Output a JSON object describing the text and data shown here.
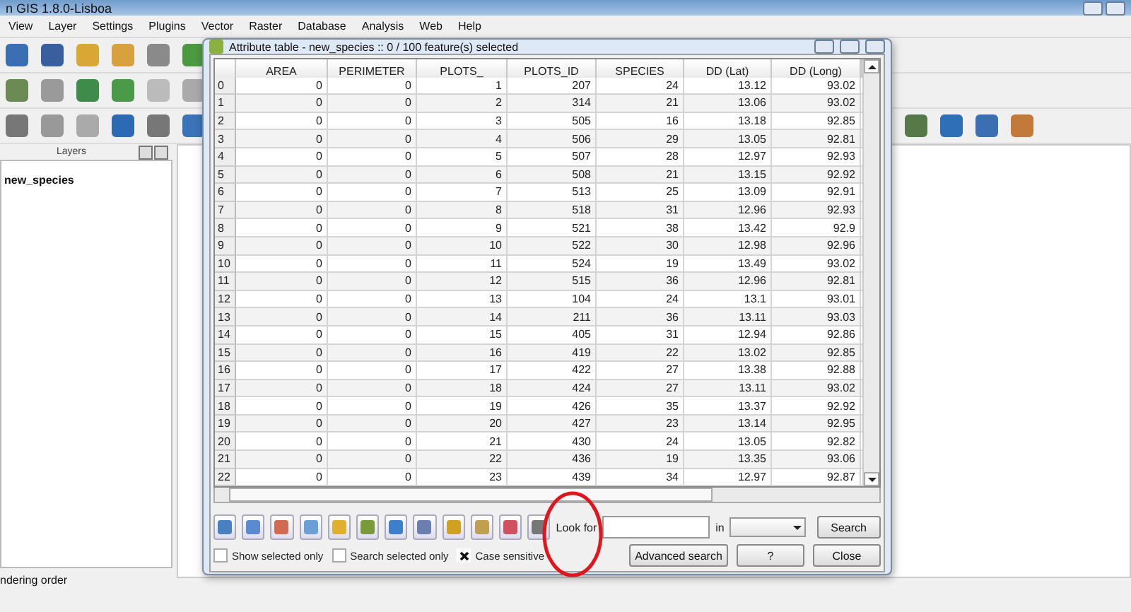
{
  "main_window": {
    "title": "n GIS 1.8.0-Lisboa",
    "menu": [
      "View",
      "Layer",
      "Settings",
      "Plugins",
      "Vector",
      "Raster",
      "Database",
      "Analysis",
      "Web",
      "Help"
    ],
    "layers_panel": {
      "title": "Layers",
      "layers": [
        {
          "name": "new_species"
        }
      ]
    },
    "status_text": "ndering order"
  },
  "attribute_table": {
    "title": "Attribute table - new_species :: 0 / 100 feature(s) selected",
    "columns": [
      "AREA",
      "PERIMETER",
      "PLOTS_",
      "PLOTS_ID",
      "SPECIES",
      "DD (Lat)",
      "DD (Long)"
    ],
    "rows": [
      {
        "header": "0",
        "cells": [
          "0",
          "0",
          "1",
          "207",
          "24",
          "13.12",
          "93.02"
        ]
      },
      {
        "header": "1",
        "cells": [
          "0",
          "0",
          "2",
          "314",
          "21",
          "13.06",
          "93.02"
        ]
      },
      {
        "header": "2",
        "cells": [
          "0",
          "0",
          "3",
          "505",
          "16",
          "13.18",
          "92.85"
        ]
      },
      {
        "header": "3",
        "cells": [
          "0",
          "0",
          "4",
          "506",
          "29",
          "13.05",
          "92.81"
        ]
      },
      {
        "header": "4",
        "cells": [
          "0",
          "0",
          "5",
          "507",
          "28",
          "12.97",
          "92.93"
        ]
      },
      {
        "header": "5",
        "cells": [
          "0",
          "0",
          "6",
          "508",
          "21",
          "13.15",
          "92.92"
        ]
      },
      {
        "header": "6",
        "cells": [
          "0",
          "0",
          "7",
          "513",
          "25",
          "13.09",
          "92.91"
        ]
      },
      {
        "header": "7",
        "cells": [
          "0",
          "0",
          "8",
          "518",
          "31",
          "12.96",
          "92.93"
        ]
      },
      {
        "header": "8",
        "cells": [
          "0",
          "0",
          "9",
          "521",
          "38",
          "13.42",
          "92.9"
        ]
      },
      {
        "header": "9",
        "cells": [
          "0",
          "0",
          "10",
          "522",
          "30",
          "12.98",
          "92.96"
        ]
      },
      {
        "header": "10",
        "cells": [
          "0",
          "0",
          "11",
          "524",
          "19",
          "13.49",
          "93.02"
        ]
      },
      {
        "header": "11",
        "cells": [
          "0",
          "0",
          "12",
          "515",
          "36",
          "12.96",
          "92.81"
        ]
      },
      {
        "header": "12",
        "cells": [
          "0",
          "0",
          "13",
          "104",
          "24",
          "13.1",
          "93.01"
        ]
      },
      {
        "header": "13",
        "cells": [
          "0",
          "0",
          "14",
          "211",
          "36",
          "13.11",
          "93.03"
        ]
      },
      {
        "header": "14",
        "cells": [
          "0",
          "0",
          "15",
          "405",
          "31",
          "12.94",
          "92.86"
        ]
      },
      {
        "header": "15",
        "cells": [
          "0",
          "0",
          "16",
          "419",
          "22",
          "13.02",
          "92.85"
        ]
      },
      {
        "header": "16",
        "cells": [
          "0",
          "0",
          "17",
          "422",
          "27",
          "13.38",
          "92.88"
        ]
      },
      {
        "header": "17",
        "cells": [
          "0",
          "0",
          "18",
          "424",
          "27",
          "13.11",
          "93.02"
        ]
      },
      {
        "header": "18",
        "cells": [
          "0",
          "0",
          "19",
          "426",
          "35",
          "13.37",
          "92.92"
        ]
      },
      {
        "header": "19",
        "cells": [
          "0",
          "0",
          "20",
          "427",
          "23",
          "13.14",
          "92.95"
        ]
      },
      {
        "header": "20",
        "cells": [
          "0",
          "0",
          "21",
          "430",
          "24",
          "13.05",
          "92.82"
        ]
      },
      {
        "header": "21",
        "cells": [
          "0",
          "0",
          "22",
          "436",
          "19",
          "13.35",
          "93.06"
        ]
      },
      {
        "header": "22",
        "cells": [
          "0",
          "0",
          "23",
          "439",
          "34",
          "12.97",
          "92.87"
        ]
      }
    ],
    "look_for_label": "Look for",
    "in_label": "in",
    "search_button": "Search",
    "options": [
      {
        "label": "Show selected only",
        "checked": false
      },
      {
        "label": "Search selected only",
        "checked": false
      },
      {
        "label": "Case sensitive",
        "checked": true
      }
    ],
    "buttons": [
      "Advanced search",
      "?",
      "Close"
    ]
  }
}
